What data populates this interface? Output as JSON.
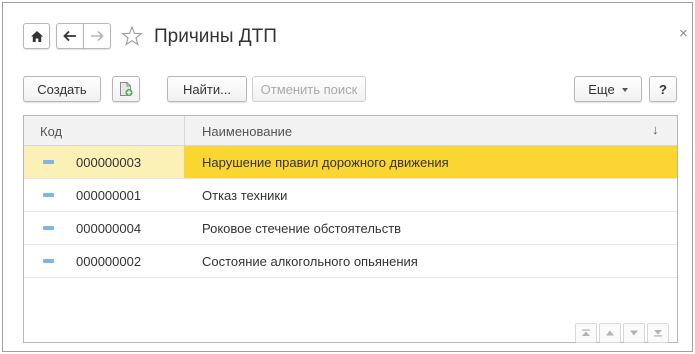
{
  "window": {
    "title": "Причины ДТП",
    "close_symbol": "×",
    "nav_icons": [
      "home-icon",
      "back-arrow-icon",
      "forward-arrow-icon",
      "star-icon"
    ]
  },
  "toolbar": {
    "create_label": "Создать",
    "copy_icon": "copy-document-icon",
    "find_label": "Найти...",
    "cancel_search_label": "Отменить поиск",
    "more_label": "Еще",
    "help_label": "?"
  },
  "table": {
    "columns": [
      "Код",
      "Наименование"
    ],
    "sort_indicator": "↓",
    "selected_row": 0,
    "rows": [
      {
        "code": "000000003",
        "name": "Нарушение правил дорожного движения"
      },
      {
        "code": "000000001",
        "name": "Отказ техники"
      },
      {
        "code": "000000004",
        "name": "Роковое стечение обстоятельств"
      },
      {
        "code": "000000002",
        "name": "Состояние алкогольного опьянения"
      }
    ]
  },
  "pager": {
    "buttons": [
      "first-page-icon",
      "prev-page-icon",
      "next-page-icon",
      "last-page-icon"
    ]
  },
  "colors": {
    "selected_row": "#f9d631",
    "row_marker": "#7fb6de",
    "border": "#b7b7b7"
  }
}
